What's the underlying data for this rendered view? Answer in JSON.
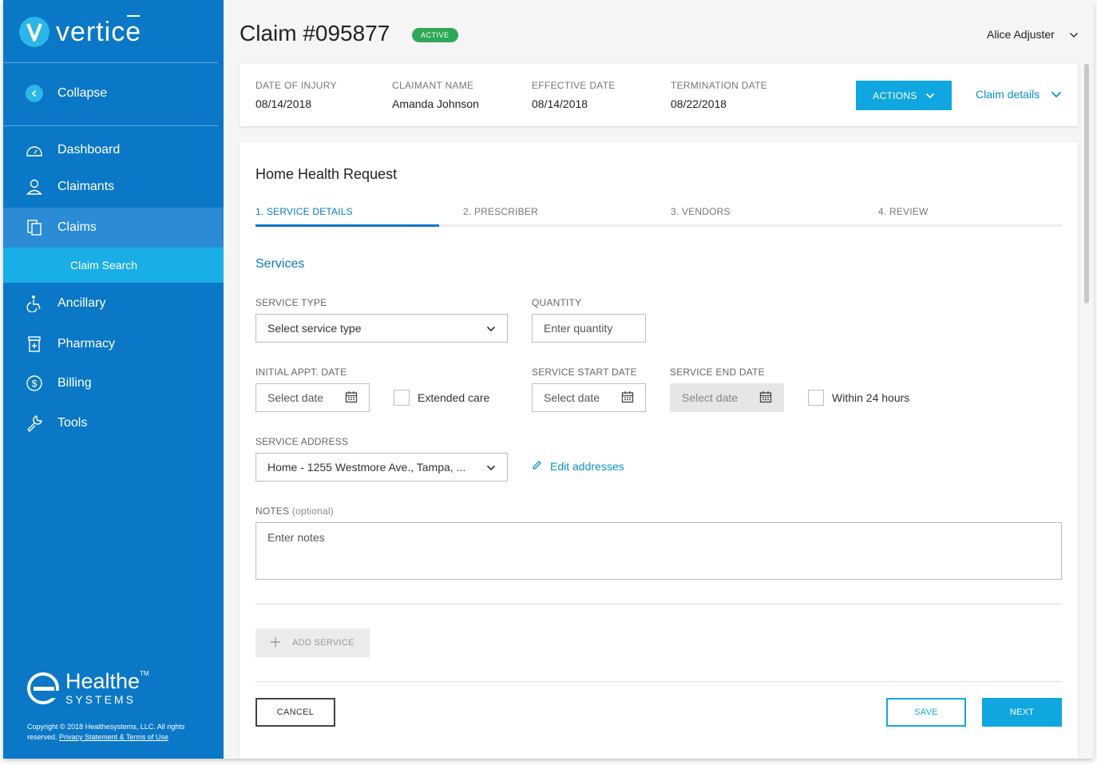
{
  "brand": {
    "name": "vertice",
    "accent": "#0a78c6",
    "highlight": "#1aaee6"
  },
  "sidebar": {
    "collapse_label": "Collapse",
    "items": [
      {
        "label": "Dashboard",
        "icon": "dashboard-icon"
      },
      {
        "label": "Claimants",
        "icon": "person-icon"
      },
      {
        "label": "Claims",
        "icon": "documents-icon",
        "active": true
      },
      {
        "label": "Ancillary",
        "icon": "accessibility-icon"
      },
      {
        "label": "Pharmacy",
        "icon": "medicine-icon"
      },
      {
        "label": "Billing",
        "icon": "dollar-icon"
      },
      {
        "label": "Tools",
        "icon": "wrench-icon"
      }
    ],
    "sub_item": "Claim Search",
    "footer": {
      "company_name": "Healthe",
      "company_suffix": "SYSTEMS",
      "tm": "TM",
      "copyright": "Copyright © 2018 Healthesystems, LLC. All rights reserved.",
      "links": "Privacy Statement & Terms of Use"
    }
  },
  "header": {
    "claim_title": "Claim #095877",
    "status": "ACTIVE",
    "status_color": "#2ea856",
    "user_name": "Alice Adjuster"
  },
  "summary": {
    "fields": [
      {
        "label": "DATE OF INJURY",
        "value": "08/14/2018"
      },
      {
        "label": "CLAIMANT NAME",
        "value": "Amanda Johnson"
      },
      {
        "label": "EFFECTIVE DATE",
        "value": "08/14/2018"
      },
      {
        "label": "TERMINATION DATE",
        "value": "08/22/2018"
      }
    ],
    "actions_label": "ACTIONS",
    "details_label": "Claim details"
  },
  "form": {
    "title": "Home Health Request",
    "steps": [
      "1. SERVICE DETAILS",
      "2. PRESCRIBER",
      "3. VENDORS",
      "4. REVIEW"
    ],
    "section_title": "Services",
    "service_type": {
      "label": "SERVICE TYPE",
      "placeholder": "Select service type"
    },
    "quantity": {
      "label": "QUANTITY",
      "placeholder": "Enter quantity"
    },
    "initial_appt": {
      "label": "INITIAL APPT. DATE",
      "placeholder": "Select date"
    },
    "extended_care": {
      "label": "Extended care",
      "checked": false
    },
    "service_start": {
      "label": "SERVICE START DATE",
      "placeholder": "Select date"
    },
    "service_end": {
      "label": "SERVICE END DATE",
      "placeholder": "Select date",
      "disabled": true
    },
    "within_24": {
      "label": "Within 24 hours",
      "checked": false
    },
    "service_address": {
      "label": "SERVICE ADDRESS",
      "value": "Home - 1255 Westmore Ave., Tampa, ..."
    },
    "edit_addresses": "Edit addresses",
    "notes": {
      "label": "NOTES",
      "optional": "(optional)",
      "placeholder": "Enter notes"
    },
    "add_service": "ADD SERVICE",
    "cancel": "CANCEL",
    "save": "SAVE",
    "next": "NEXT"
  }
}
